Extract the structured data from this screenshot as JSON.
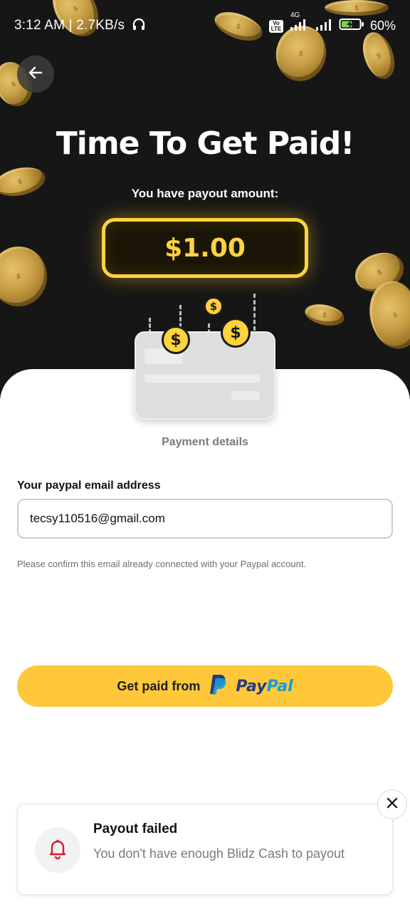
{
  "status_bar": {
    "time_speed": "3:12 AM | 2.7KB/s",
    "headset_icon": "headphones-icon",
    "volte": "Vo LTE",
    "network": "4G",
    "battery_percent": "60%",
    "battery_level": 0.6,
    "battery_color": "#7bd24b"
  },
  "header": {
    "back_icon": "arrow-left-icon",
    "title": "Time To Get Paid!",
    "subtitle": "You have payout amount:",
    "amount": "$1.00"
  },
  "colors": {
    "accent_yellow": "#ffd23f",
    "button_yellow": "#ffc83a",
    "hero_background": "#161616",
    "alert_red": "#d11f2b"
  },
  "payment": {
    "section_title": "Payment details",
    "email_label": "Your paypal email address",
    "email_value": "tecsy110516@gmail.com",
    "hint": "Please confirm this email already connected with your Paypal account.",
    "button_label": "Get paid from",
    "paypal_pay": "Pay",
    "paypal_pal": "Pal"
  },
  "toast": {
    "icon": "bell-icon",
    "title": "Payout failed",
    "message": "You don't have enough Blidz Cash to payout",
    "close_icon": "close-icon"
  }
}
